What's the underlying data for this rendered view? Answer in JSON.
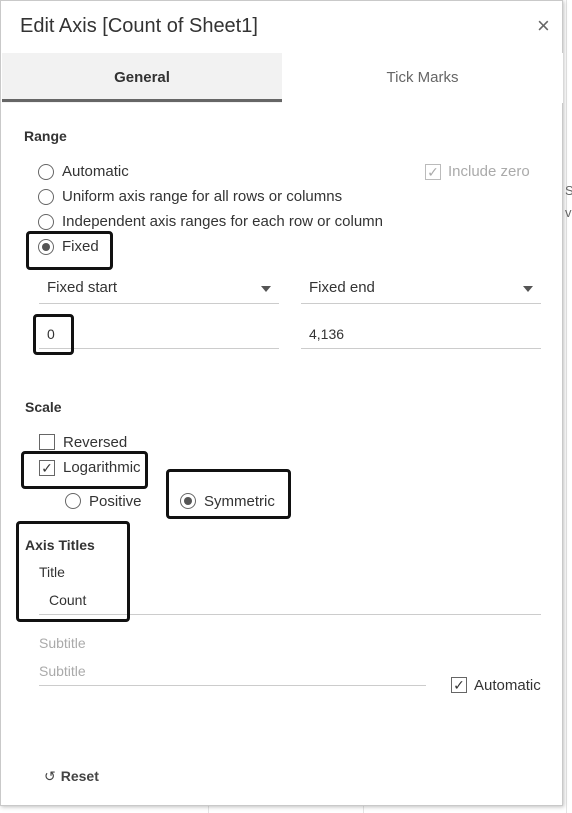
{
  "dialog": {
    "title": "Edit Axis [Count of Sheet1]",
    "close_glyph": "×"
  },
  "tabs": [
    {
      "label": "General",
      "active": true
    },
    {
      "label": "Tick Marks",
      "active": false
    }
  ],
  "range": {
    "heading": "Range",
    "options": [
      {
        "label": "Automatic",
        "selected": false
      },
      {
        "label": "Uniform axis range for all rows or columns",
        "selected": false
      },
      {
        "label": "Independent axis ranges for each row or column",
        "selected": false
      },
      {
        "label": "Fixed",
        "selected": true
      }
    ],
    "include_zero": {
      "label": "Include zero",
      "checked": true,
      "enabled": false
    },
    "fixed_start": {
      "label": "Fixed start",
      "value": "0"
    },
    "fixed_end": {
      "label": "Fixed end",
      "value": "4,136"
    }
  },
  "scale": {
    "heading": "Scale",
    "reversed": {
      "label": "Reversed",
      "checked": false
    },
    "logarithmic": {
      "label": "Logarithmic",
      "checked": true
    },
    "positive": {
      "label": "Positive",
      "selected": false
    },
    "symmetric": {
      "label": "Symmetric",
      "selected": true
    }
  },
  "axis_titles": {
    "heading": "Axis Titles",
    "title_label": "Title",
    "title_value": "Count",
    "subtitle_label": "Subtitle",
    "subtitle_placeholder": "Subtitle",
    "automatic": {
      "label": "Automatic",
      "checked": true
    }
  },
  "footer": {
    "reset_label": "Reset",
    "reset_icon": "undo-icon"
  },
  "background": {
    "fragment_1": "S",
    "fragment_2": "v"
  },
  "colors": {
    "annotation": "#111111",
    "tab_active_underline": "#666666",
    "tab_background": "#f2f2f2"
  }
}
